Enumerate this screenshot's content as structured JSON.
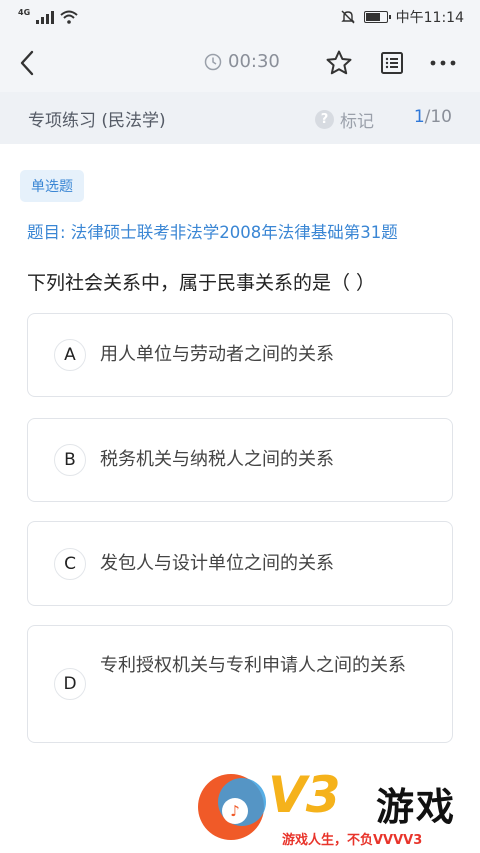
{
  "status_bar": {
    "network": "4G",
    "time": "中午11:14"
  },
  "nav": {
    "timer": "00:30",
    "icons": [
      "back-arrow-icon",
      "clock-icon",
      "star-icon",
      "answer-sheet-icon",
      "more-icon"
    ]
  },
  "sub_header": {
    "title": "专项练习 (民法学)",
    "mark_label": "标记",
    "progress_current": "1",
    "progress_total": "/10"
  },
  "question": {
    "type_tag": "单选题",
    "source": "题目: 法律硕士联考非法学2008年法律基础第31题",
    "stem": "下列社会关系中，属于民事关系的是（  ）",
    "options": [
      {
        "letter": "A",
        "text": "用人单位与劳动者之间的关系"
      },
      {
        "letter": "B",
        "text": "税务机关与纳税人之间的关系"
      },
      {
        "letter": "C",
        "text": "发包人与设计单位之间的关系"
      },
      {
        "letter": "D",
        "text": "专利授权机关与专利申请人之间的关系"
      }
    ]
  },
  "watermark": {
    "brand": "V3",
    "game": "游戏",
    "slogan": "游戏人生，不负VVVV3"
  },
  "colors": {
    "accent": "#2f78d8",
    "tag_bg": "#e6f1fb",
    "header_bg": "#f3f5f8",
    "subheader_bg": "#eef1f5"
  }
}
